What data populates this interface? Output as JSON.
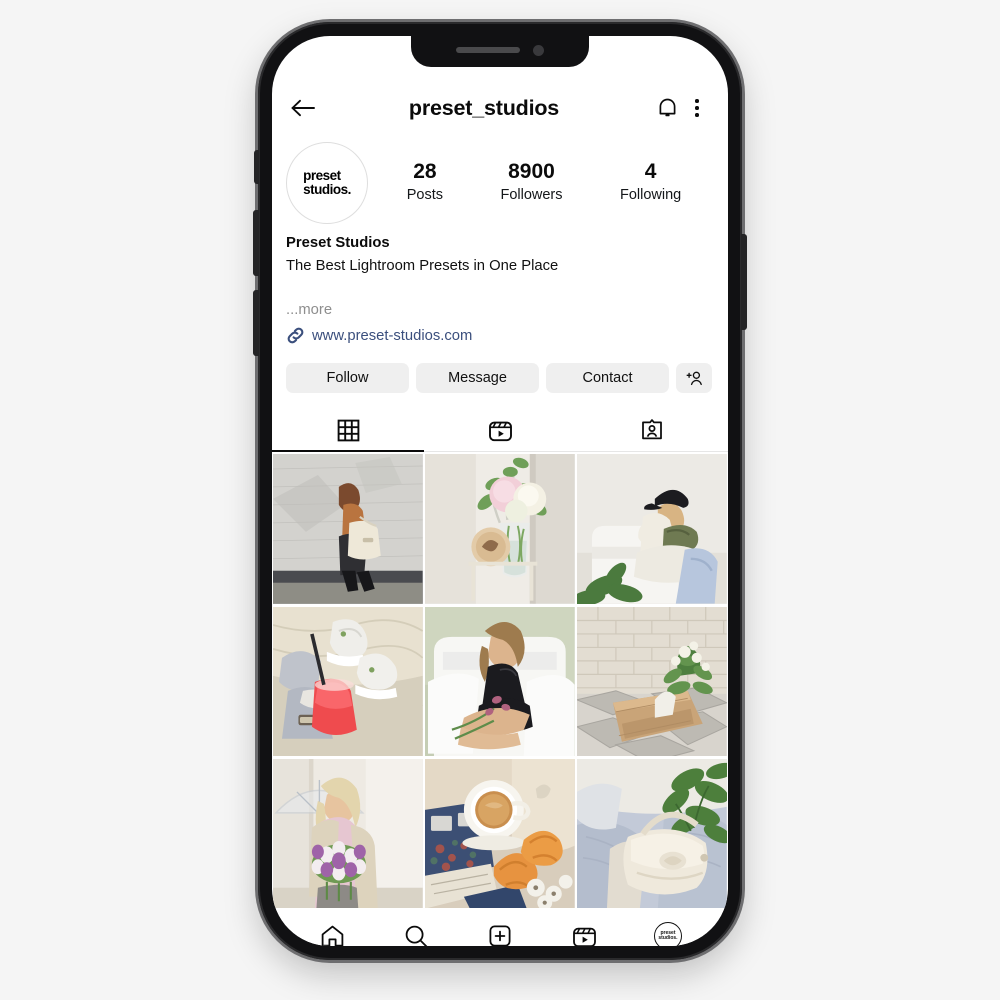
{
  "app": {
    "platform": "instagram-profile",
    "header": {
      "username": "preset_studios",
      "back_icon": "arrow-left-icon",
      "bell_icon": "bell-icon",
      "menu_icon": "menu-dots-icon"
    },
    "avatar": {
      "logo_text": "preset\nstudios.",
      "nav_logo_text": "preset\nstudios."
    },
    "stats": [
      {
        "value": "28",
        "label": "Posts"
      },
      {
        "value": "8900",
        "label": "Followers"
      },
      {
        "value": "4",
        "label": "Following"
      }
    ],
    "bio": {
      "display_name": "Preset Studios",
      "description": "The Best Lightroom Presets in One Place",
      "more_label": "...more",
      "website": "www.preset-studios.com",
      "website_color": "#3b4f7d",
      "link_icon": "link-icon"
    },
    "actions": [
      {
        "label": "Follow",
        "name": "follow-button"
      },
      {
        "label": "Message",
        "name": "message-button"
      },
      {
        "label": "Contact",
        "name": "contact-button"
      }
    ],
    "add_person_icon": "add-person-icon",
    "tabs": [
      {
        "icon": "grid-icon",
        "name": "tab-grid",
        "active": true
      },
      {
        "icon": "reels-icon",
        "name": "tab-reels",
        "active": false
      },
      {
        "icon": "tagged-icon",
        "name": "tab-tagged",
        "active": false
      }
    ],
    "grid": [
      {
        "alt": "woman-with-tote-bag-at-grey-brick-wall"
      },
      {
        "alt": "pink-and-white-peonies-in-glass-vase"
      },
      {
        "alt": "woman-in-black-cap-on-white-armchair"
      },
      {
        "alt": "red-drink-and-white-sneakers"
      },
      {
        "alt": "woman-in-black-dress-on-white-sofa"
      },
      {
        "alt": "wooden-flower-box-against-brick-wall"
      },
      {
        "alt": "woman-with-umbrella-holding-tulips"
      },
      {
        "alt": "coffee-cup-with-croissants-flatlay"
      },
      {
        "alt": "cream-handbag-with-green-leaves"
      }
    ],
    "bottom_nav": [
      {
        "icon": "home-icon",
        "name": "nav-home"
      },
      {
        "icon": "search-icon",
        "name": "nav-search"
      },
      {
        "icon": "add-icon",
        "name": "nav-add"
      },
      {
        "icon": "reels-icon",
        "name": "nav-reels"
      },
      {
        "icon": "avatar-icon",
        "name": "nav-profile"
      }
    ]
  },
  "device": {
    "notch": {
      "speaker": "speaker-grille",
      "camera": "front-camera"
    },
    "buttons": [
      "mute-switch",
      "volume-up",
      "volume-down",
      "power"
    ]
  }
}
